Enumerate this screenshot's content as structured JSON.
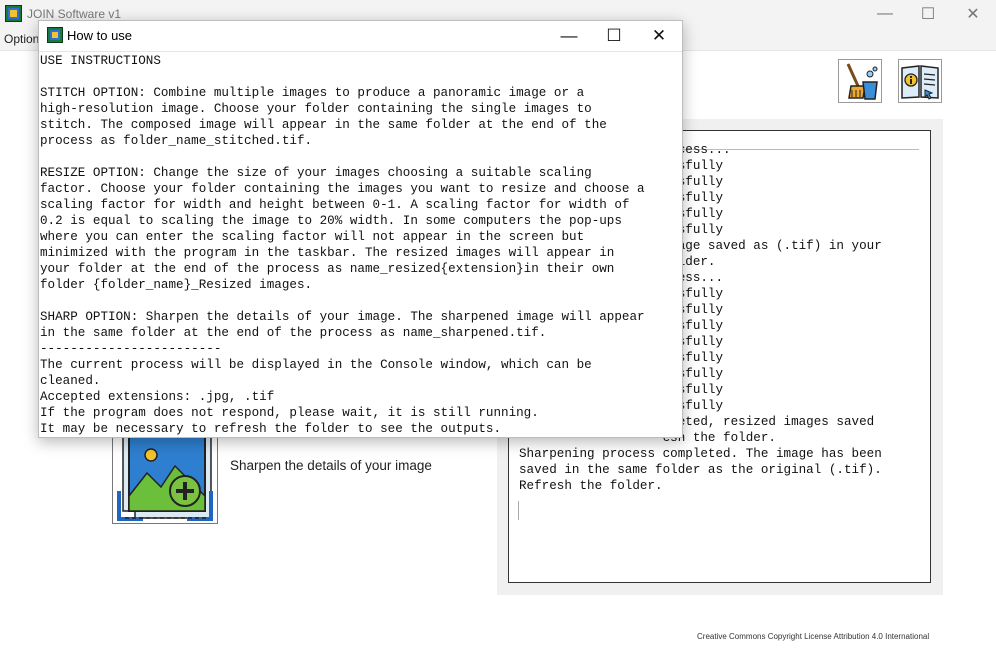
{
  "main_window": {
    "title": "JOIN Software v1",
    "minimize": "—",
    "maximize": "☐",
    "close": "✕",
    "menu": {
      "options": "Option"
    }
  },
  "toolbar": {
    "clean_icon": "broom-bucket-icon",
    "help_icon": "info-manual-icon"
  },
  "console": {
    "text": "                   rocess...\n                   essfully\n                   essfully\n                   essfully\n                   essfully\n                   essfully\n                   Image saved as (.tif) in your\n                   folder.\n                   ocess...\n                   essfully\n                   essfully\n                   essfully\n                   essfully\n                   essfully\n                   essfully\n                   essfully\n                   essfully\n                   pleted, resized images saved\n                   esh the folder.\nSharpening process completed. The image has been\nsaved in the same folder as the original (.tif).\nRefresh the folder."
  },
  "sharp": {
    "label": "Sharpen the details of your image",
    "icon": "sharpen-image-icon"
  },
  "license": "Creative Commons Copyright License Attribution 4.0 International",
  "dialog": {
    "title": "How to use",
    "minimize": "—",
    "maximize": "☐",
    "close": "✕",
    "text": "USE INSTRUCTIONS\n\nSTITCH OPTION: Combine multiple images to produce a panoramic image or a\nhigh-resolution image. Choose your folder containing the single images to\nstitch. The composed image will appear in the same folder at the end of the\nprocess as folder_name_stitched.tif.\n\nRESIZE OPTION: Change the size of your images choosing a suitable scaling\nfactor. Choose your folder containing the images you want to resize and choose a\nscaling factor for width and height between 0-1. A scaling factor for width of\n0.2 is equal to scaling the image to 20% width. In some computers the pop-ups\nwhere you can enter the scaling factor will not appear in the screen but\nminimized with the program in the taskbar. The resized images will appear in\nyour folder at the end of the process as name_resized{extension}in their own\nfolder {folder_name}_Resized images.\n\nSHARP OPTION: Sharpen the details of your image. The sharpened image will appear\nin the same folder at the end of the process as name_sharpened.tif.\n------------------------\nThe current process will be displayed in the Console window, which can be\ncleaned.\nAccepted extensions: .jpg, .tif\nIf the program does not respond, please wait, it is still running.\nIt may be necessary to refresh the folder to see the outputs."
  }
}
